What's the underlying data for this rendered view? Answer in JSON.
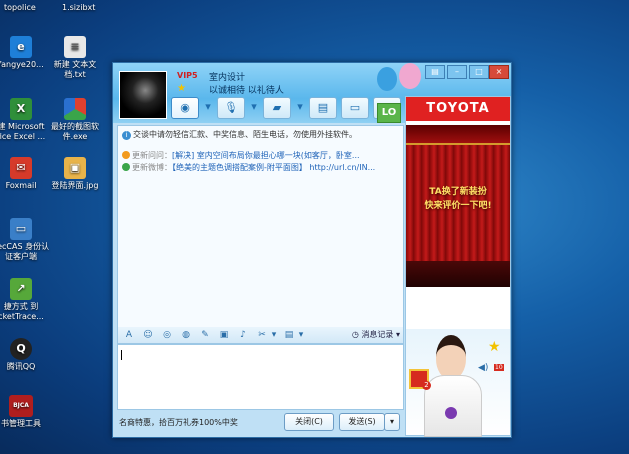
{
  "desktop": {
    "top_labels": [
      "topolice",
      "1.sizibxt"
    ],
    "icons": [
      {
        "label": "fangye20...",
        "icon": "ie-icon",
        "color": "#1e7fd8"
      },
      {
        "label": "新建 文本文档.txt",
        "icon": "text-file-icon",
        "color": "#e8e8e8"
      },
      {
        "label": "建 Microsoft fice Excel ...",
        "icon": "excel-icon",
        "color": "#2f8f3a"
      },
      {
        "label": "最好的截图软件.exe",
        "icon": "screenshot-app-icon",
        "color": "#e0402e"
      },
      {
        "label": "Foxmail",
        "icon": "foxmail-icon",
        "color": "#d63a2a"
      },
      {
        "label": "登陆界面.jpg",
        "icon": "image-file-icon",
        "color": "#e8b34a"
      },
      {
        "label": "secCAS 身份认证客户端",
        "icon": "computer-icon",
        "color": "#3a7fc8"
      },
      {
        "label": "捷方式 到 cketTrace...",
        "icon": "shortcut-icon",
        "color": "#56a83a"
      },
      {
        "label": "腾讯QQ",
        "icon": "qq-icon",
        "color": "#222222"
      },
      {
        "label": "书管理工具",
        "icon": "bjca-icon",
        "color": "#b01e1e",
        "badge": "BJCA"
      }
    ]
  },
  "chat": {
    "vip_label": "VIP5",
    "contact_name": "室内设计",
    "signature": "以诚相待 以礼待人",
    "lo_badge": "LO",
    "notice": "交谈中请勿轻信汇款、中奖信息、陌生电话，勿使用外挂软件。",
    "news": [
      {
        "label": "更新问问：",
        "text": "[解决] 室内空间布局你最担心哪一块(如客厅，卧室..."
      },
      {
        "label": "更新微博：",
        "text": "【绝美的主题色调搭配案例-附平面图】 http://url.cn/IN..."
      }
    ],
    "history_label": "消息记录",
    "promo_text": "名商特惠，拾百万礼券100%中奖",
    "close_button": "关闭(C)",
    "send_button": "发送(S)"
  },
  "ad": {
    "brand": "TOYOTA",
    "line1": "TA换了新装扮",
    "line2": "快来评价一下吧!",
    "gift_count": "2",
    "sound_count": "10"
  }
}
